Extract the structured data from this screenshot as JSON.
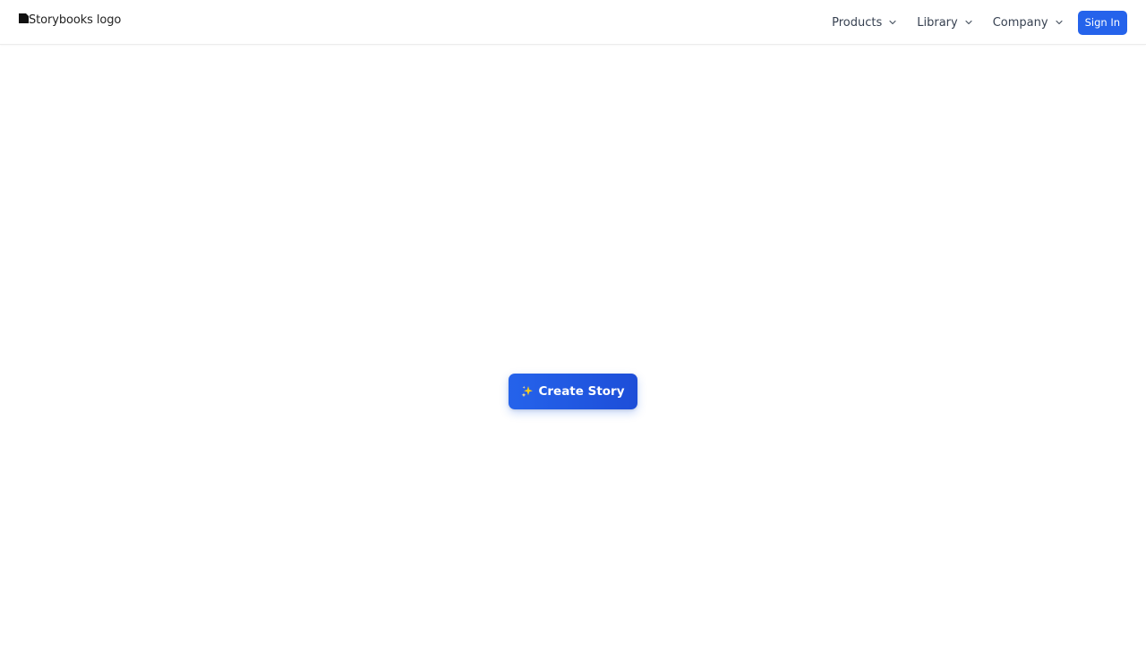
{
  "header": {
    "logo_alt_text": "Storybooks logo",
    "nav": [
      {
        "label": "Products"
      },
      {
        "label": "Library"
      },
      {
        "label": "Company"
      }
    ],
    "sign_in_label": "Sign In"
  },
  "main": {
    "create_story_label": "Create Story",
    "create_story_icon": "sparkles-icon"
  },
  "colors": {
    "primary": "#2563eb",
    "primary_dark": "#1d4ed8",
    "sparkle": "#facc15",
    "text": "#374151"
  }
}
